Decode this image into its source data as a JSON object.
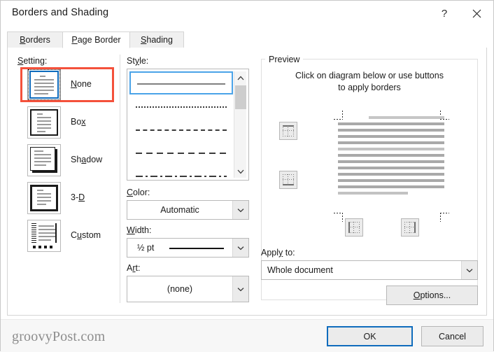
{
  "window": {
    "title": "Borders and Shading",
    "help_label": "?",
    "close_label": "✕"
  },
  "tabs": [
    {
      "label": "Borders",
      "accel": "B",
      "active": false
    },
    {
      "label": "Page Border",
      "accel": "P",
      "active": true
    },
    {
      "label": "Shading",
      "accel": "S",
      "active": false
    }
  ],
  "setting": {
    "label": "Setting:",
    "label_accel": "S",
    "selected": "None",
    "items": [
      {
        "name": "None",
        "accel": "N",
        "selected": true,
        "annotated": true
      },
      {
        "name": "Box",
        "accel": "x",
        "selected": false,
        "annotated": false
      },
      {
        "name": "Shadow",
        "accel": "a",
        "selected": false,
        "annotated": false
      },
      {
        "name": "3-D",
        "accel": "D",
        "selected": false,
        "annotated": false
      },
      {
        "name": "Custom",
        "accel": "u",
        "selected": false,
        "annotated": false
      }
    ],
    "annotation_color": "#f4513b"
  },
  "style": {
    "label": "Style:",
    "label_accel": "y",
    "selected_index": 0,
    "options": [
      {
        "name": "solid-line",
        "kind": "sr-solid"
      },
      {
        "name": "dotted-line",
        "kind": "sr-dotted"
      },
      {
        "name": "dashed-line",
        "kind": "sr-dashed"
      },
      {
        "name": "long-dashed-line",
        "kind": "sr-longdash"
      },
      {
        "name": "dash-dot-line",
        "kind": "sr-dashdot"
      }
    ]
  },
  "color": {
    "label": "Color:",
    "label_accel": "C",
    "value": "Automatic"
  },
  "width": {
    "label": "Width:",
    "label_accel": "W",
    "value": "½ pt"
  },
  "art": {
    "label": "Art:",
    "label_accel": "r",
    "value": "(none)"
  },
  "preview": {
    "group_title": "Preview",
    "hint_line1": "Click on diagram below or use buttons",
    "hint_line2": "to apply borders"
  },
  "apply_to": {
    "label": "Apply to:",
    "label_accel": "y",
    "value": "Whole document"
  },
  "options_button": {
    "label": "Options...",
    "accel": "O"
  },
  "footer": {
    "watermark": "groovyPost.com",
    "ok_label": "OK",
    "cancel_label": "Cancel"
  },
  "colors": {
    "accent": "#0f6cbd",
    "annotation": "#f4513b",
    "dialog_bg": "#ffffff",
    "footer_bg": "#f7f7f7",
    "button_bg": "#ebebeb"
  }
}
